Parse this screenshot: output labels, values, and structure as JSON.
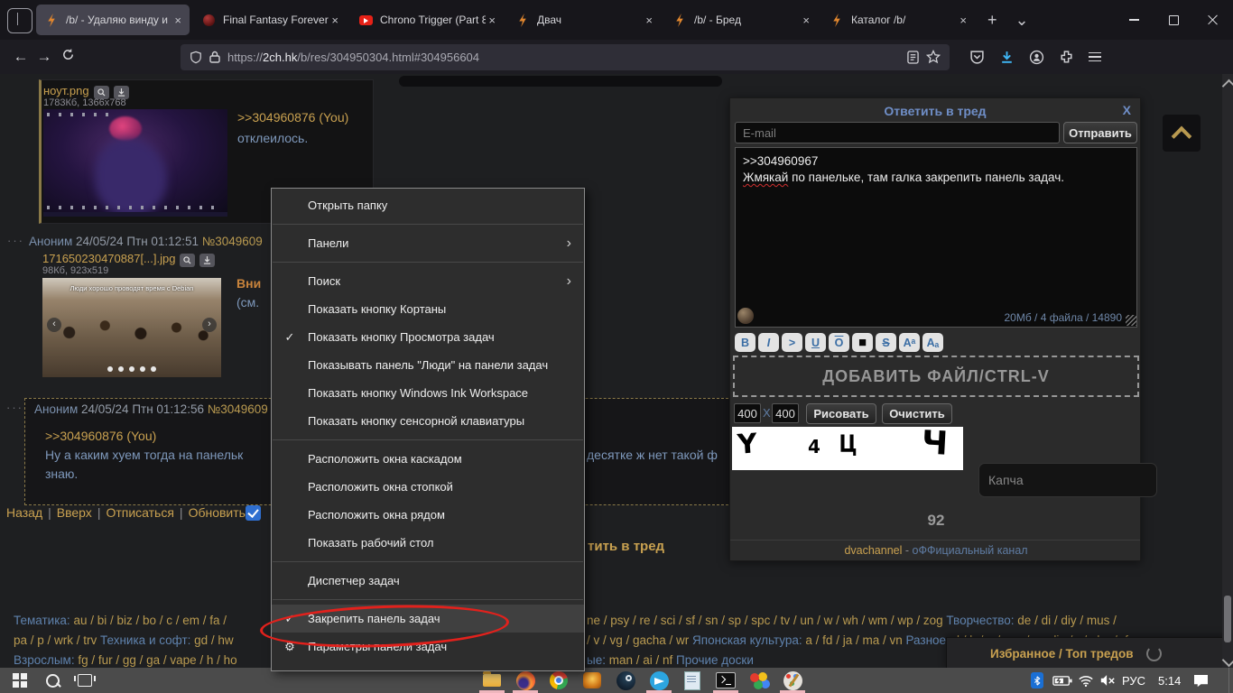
{
  "browser": {
    "tabs": [
      {
        "label": "/b/ - Удаляю винду и",
        "icon": "bolt",
        "active": true
      },
      {
        "label": "Final Fantasy Forever ::",
        "icon": "fff",
        "active": false
      },
      {
        "label": "Chrono Trigger (Part 8",
        "icon": "yt",
        "active": false
      },
      {
        "label": "Двач",
        "icon": "bolt",
        "active": false
      },
      {
        "label": "/b/ - Бред",
        "icon": "bolt",
        "active": false
      },
      {
        "label": "Каталог /b/",
        "icon": "bolt",
        "active": false
      }
    ],
    "url_scheme": "https://",
    "url_host": "2ch.hk",
    "url_path": "/b/res/304950304.html#304956604"
  },
  "thread": {
    "post1": {
      "filename": "ноут.png",
      "meta": "1783Кб, 1366x768",
      "reply_link": ">>304960876 (You)",
      "text": "отклеилось."
    },
    "post2": {
      "dots": "···",
      "name": "Аноним",
      "date": "24/05/24 Птн 01:12:51",
      "num": "№3049609",
      "filename": "171650230470887[...].jpg",
      "meta": "98Кб, 923x519",
      "caption": "Люди хорошо проводят время с Debian",
      "prev": "‹",
      "next": "›",
      "partial_warn": "Вни",
      "partial_see": "(см."
    },
    "post3": {
      "dots": "···",
      "name": "Аноним",
      "date": "24/05/24 Птн 01:12:56",
      "num": "№3049609",
      "reply_link": ">>304960876 (You)",
      "line_left": "Ну а каким хуем тогда на панельк",
      "line_right": "десятке ж нет такой ф",
      "line_end": "знаю."
    },
    "nav_links": [
      "Назад",
      "Вверх",
      "Отписаться",
      "Обновить"
    ],
    "nav_sep": "|",
    "reply_partial": "тить в тред"
  },
  "context_menu": {
    "items": [
      {
        "id": "open-folder",
        "label": "Открыть папку"
      },
      {
        "type": "sep"
      },
      {
        "id": "panels",
        "label": "Панели",
        "submenu": true
      },
      {
        "type": "sep"
      },
      {
        "id": "search",
        "label": "Поиск",
        "submenu": true
      },
      {
        "id": "cortana-button",
        "label": "Показать кнопку Кортаны"
      },
      {
        "id": "task-view-button",
        "label": "Показать кнопку Просмотра задач",
        "checked": true
      },
      {
        "id": "people-panel",
        "label": "Показывать панель \"Люди\" на панели задач"
      },
      {
        "id": "ink-workspace",
        "label": "Показать кнопку Windows Ink Workspace"
      },
      {
        "id": "touch-keyboard",
        "label": "Показать кнопку сенсорной клавиатуры"
      },
      {
        "type": "sep"
      },
      {
        "id": "cascade-windows",
        "label": "Расположить окна каскадом"
      },
      {
        "id": "stack-windows",
        "label": "Расположить окна стопкой"
      },
      {
        "id": "side-windows",
        "label": "Расположить окна рядом"
      },
      {
        "id": "show-desktop",
        "label": "Показать рабочий стол"
      },
      {
        "type": "sep"
      },
      {
        "id": "task-manager",
        "label": "Диспетчер задач"
      },
      {
        "type": "sep"
      },
      {
        "id": "lock-taskbar",
        "label": "Закрепить панель задач",
        "checked": true,
        "highlighted": true
      },
      {
        "id": "taskbar-settings",
        "label": "Параметры панели задач",
        "gear": true
      }
    ],
    "check_glyph": "✓",
    "gear_glyph": "⚙",
    "arrow_glyph": "›"
  },
  "annotation": {
    "shape": "ellipse",
    "color": "#e2211c"
  },
  "reply_form": {
    "title": "Ответить в тред",
    "close": "X",
    "email_placeholder": "E-mail",
    "submit": "Отправить",
    "message_line1": ">>304960967",
    "misspelled_word": "Жмякай",
    "message_line2_rest": " по панельке, там галка закрепить панель задач.",
    "limits": "20Мб / 4 файла / 14890",
    "format_buttons": [
      {
        "t": "B",
        "s": "b"
      },
      {
        "t": "I",
        "s": "i"
      },
      {
        "t": ">",
        "s": "q"
      },
      {
        "t": "U",
        "s": "u"
      },
      {
        "t": "O",
        "s": "o"
      },
      {
        "t": "■",
        "s": "sp"
      },
      {
        "t": "S",
        "s": "s"
      },
      {
        "t": "Aᵃ",
        "s": "sup"
      },
      {
        "t": "Aₐ",
        "s": "sub"
      }
    ],
    "dropzone": "ДОБАВИТЬ ФАЙЛ/CTRL-V",
    "width_value": "400",
    "dim_sep": "X",
    "height_value": "400",
    "draw": "Рисовать",
    "clear": "Очистить",
    "captcha_glyphs": [
      "Y",
      "4",
      "Ц",
      "Ч"
    ],
    "captcha_placeholder": "Капча",
    "counter": "92",
    "footer_channel": "dvachannel",
    "footer_sep": "-",
    "footer_link": "оФФициальный канал"
  },
  "board_links": {
    "l1_left": [
      {
        "t": "Тематика: ",
        "c": "cat"
      },
      {
        "t": "au / bi / biz / bo / c / em / fa /",
        "c": "b"
      }
    ],
    "l1_right": [
      {
        "t": "ne / psy / re / sci / sf / sn / sp / spc / tv / un / w / wh / wm / wp / zog ",
        "c": "b"
      },
      {
        "t": "Творчество: ",
        "c": "cat"
      },
      {
        "t": "de / di / diy / mus /",
        "c": "b"
      }
    ],
    "l2_left": [
      {
        "t": "pa / p / wrk / trv ",
        "c": "b"
      },
      {
        "t": "Техника и софт: ",
        "c": "cat"
      },
      {
        "t": "gd / hw",
        "c": "b"
      }
    ],
    "l2_right": [
      {
        "t": "/ v / vg / gacha / wr ",
        "c": "b"
      },
      {
        "t": "Японская культура: ",
        "c": "cat"
      },
      {
        "t": "a / fd / ja / ma / vn ",
        "c": "b"
      },
      {
        "t": "Разное: ",
        "c": "cat"
      },
      {
        "t": "d / b / o / soc / media / r / abu / rf",
        "c": "b"
      }
    ],
    "l3_left": [
      {
        "t": "Взрослым: ",
        "c": "cat"
      },
      {
        "t": "fg / fur / gg / ga / vape / h / ho",
        "c": "b"
      }
    ],
    "l3_right": [
      {
        "t": "ые: ",
        "c": "cat"
      },
      {
        "t": "man / ai / nf  ",
        "c": "b"
      },
      {
        "t": "Прочие доски",
        "c": "cat"
      }
    ]
  },
  "favorites_popup": {
    "label": "Избранное / Топ тредов"
  },
  "taskbar": {
    "lang": "РУС",
    "time": "5:14"
  }
}
